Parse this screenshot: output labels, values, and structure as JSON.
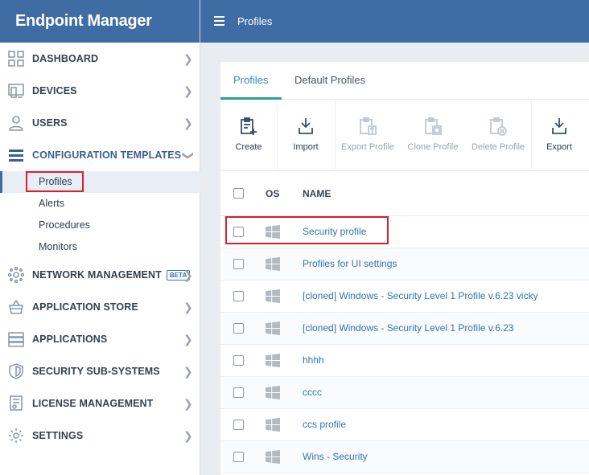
{
  "app": {
    "title": "Endpoint Manager"
  },
  "header": {
    "title": "Profiles"
  },
  "sidebar": {
    "items": [
      {
        "label": "DASHBOARD"
      },
      {
        "label": "DEVICES"
      },
      {
        "label": "USERS"
      },
      {
        "label": "CONFIGURATION TEMPLATES"
      },
      {
        "label": "NETWORK MANAGEMENT",
        "badge": "BETA"
      },
      {
        "label": "APPLICATION STORE"
      },
      {
        "label": "APPLICATIONS"
      },
      {
        "label": "SECURITY SUB-SYSTEMS"
      },
      {
        "label": "LICENSE MANAGEMENT"
      },
      {
        "label": "SETTINGS"
      }
    ],
    "subitems": [
      {
        "label": "Profiles"
      },
      {
        "label": "Alerts"
      },
      {
        "label": "Procedures"
      },
      {
        "label": "Monitors"
      }
    ]
  },
  "tabs": [
    {
      "label": "Profiles"
    },
    {
      "label": "Default Profiles"
    }
  ],
  "toolbar": {
    "create": "Create",
    "import": "Import",
    "export_profile": "Export Profile",
    "clone_profile": "Clone Profile",
    "delete_profile": "Delete Profile",
    "export": "Export"
  },
  "table": {
    "columns": {
      "os": "OS",
      "name": "NAME"
    },
    "rows": [
      {
        "name": "Security profile"
      },
      {
        "name": "Profiles for UI settings"
      },
      {
        "name": "[cloned] Windows - Security Level 1 Profile v.6.23 vicky"
      },
      {
        "name": "[cloned] Windows - Security Level 1 Profile v.6.23"
      },
      {
        "name": "hhhh"
      },
      {
        "name": "cccc"
      },
      {
        "name": "ccs profile"
      },
      {
        "name": "Wins - Security"
      }
    ]
  },
  "colors": {
    "brand": "#3f6ca3",
    "highlight": "#d9202b",
    "link": "#2f74b5",
    "tab_accent": "#2aa198"
  }
}
